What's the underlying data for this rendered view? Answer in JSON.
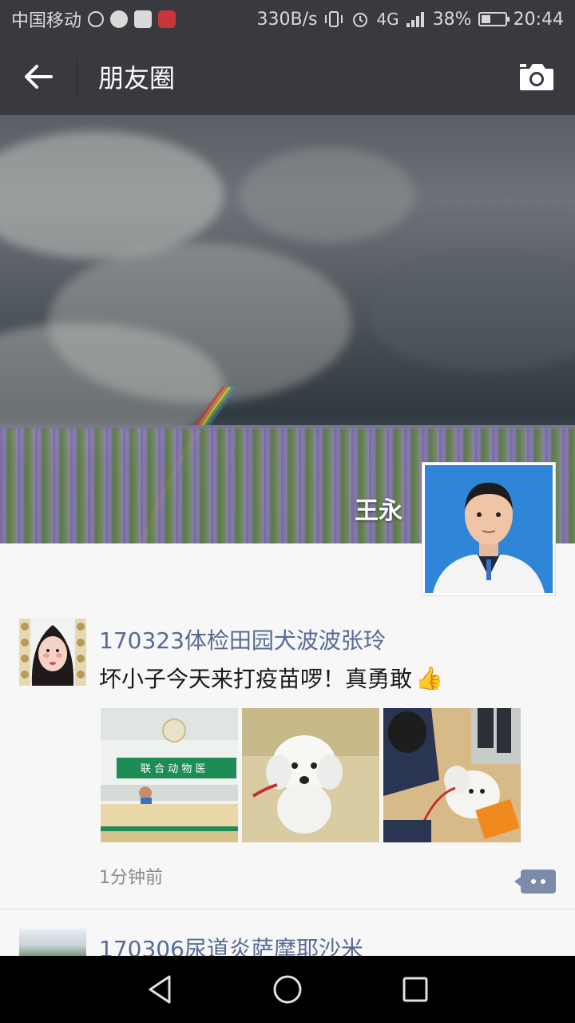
{
  "status_bar": {
    "carrier": "中国移动",
    "net_speed": "330B/s",
    "network": "4G",
    "battery": "38%",
    "battery_level": 0.38,
    "time": "20:44"
  },
  "header": {
    "back_icon": "arrow-left-icon",
    "title": "朋友圈",
    "camera_icon": "camera-icon"
  },
  "profile": {
    "name": "王永"
  },
  "posts": [
    {
      "name": "170323体检田园犬波波张玲",
      "text": "坏小子今天来打疫苗啰！真勇敢",
      "emoji": "👍",
      "image_sign": "联 合 动 物 医",
      "time": "1分钟前"
    },
    {
      "name": "170306尿道炎萨摩耶沙米"
    }
  ],
  "colors": {
    "bar": "#393a3f",
    "link": "#576b95",
    "comment_button": "#7d8bab"
  }
}
